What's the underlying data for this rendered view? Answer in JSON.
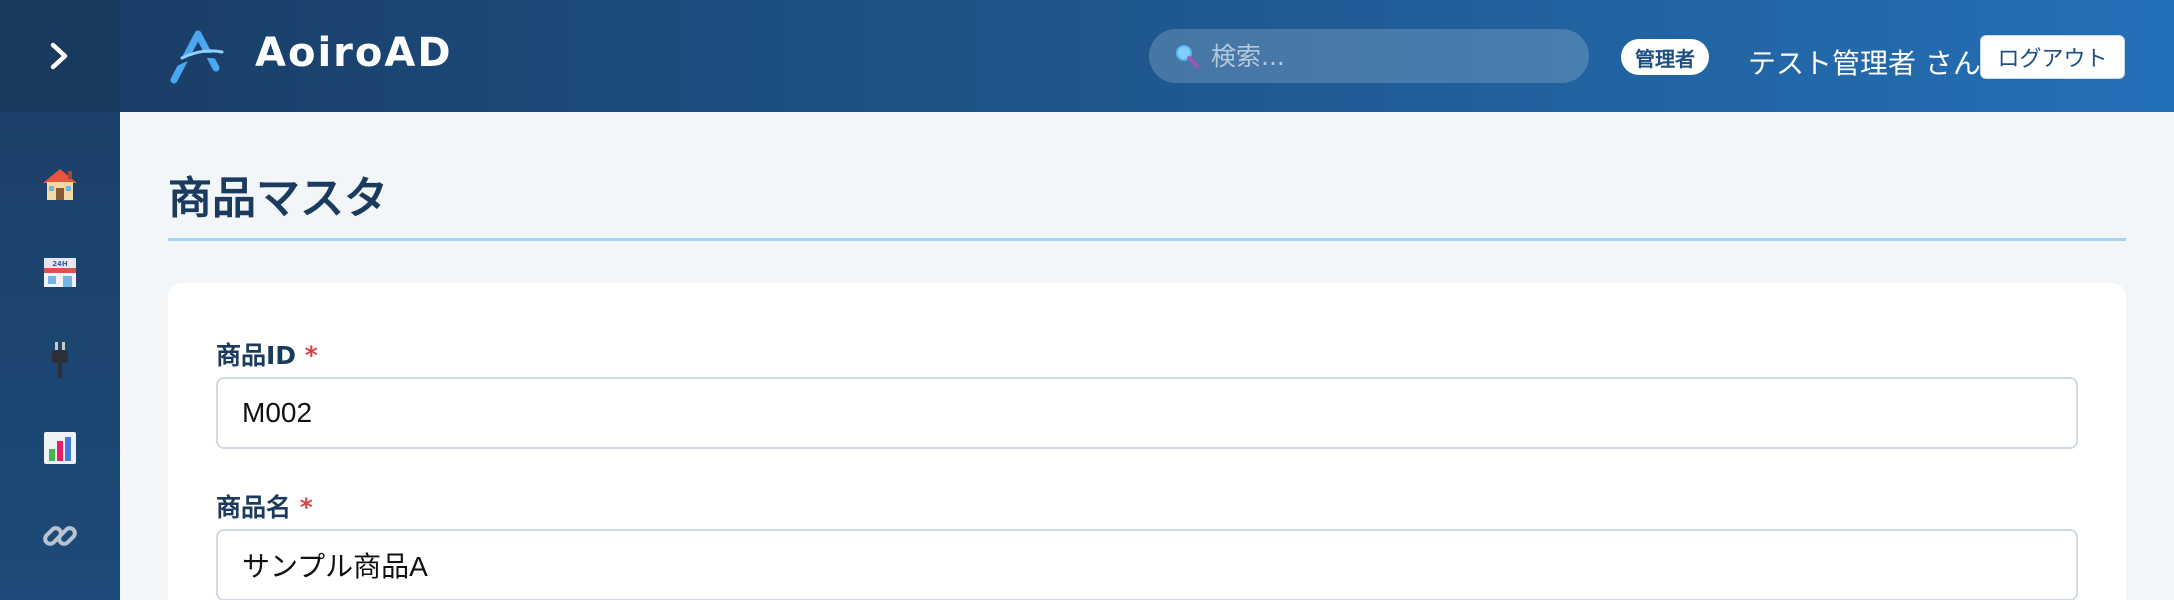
{
  "app": {
    "brand": "AoiroAD"
  },
  "search": {
    "placeholder": "検索..."
  },
  "user": {
    "role": "管理者",
    "name": "テスト管理者 さん",
    "logout_label": "ログアウト"
  },
  "sidebar": {
    "toggle_icon": "chevron-right-icon",
    "items": [
      {
        "icon": "house-icon"
      },
      {
        "icon": "convenience-store-icon"
      },
      {
        "icon": "electric-plug-icon"
      },
      {
        "icon": "bar-chart-icon"
      },
      {
        "icon": "link-icon"
      }
    ]
  },
  "page": {
    "title": "商品マスタ"
  },
  "form": {
    "required_mark": "*",
    "fields": [
      {
        "label": "商品ID",
        "value": "M002"
      },
      {
        "label": "商品名",
        "value": "サンプル商品A"
      }
    ]
  }
}
